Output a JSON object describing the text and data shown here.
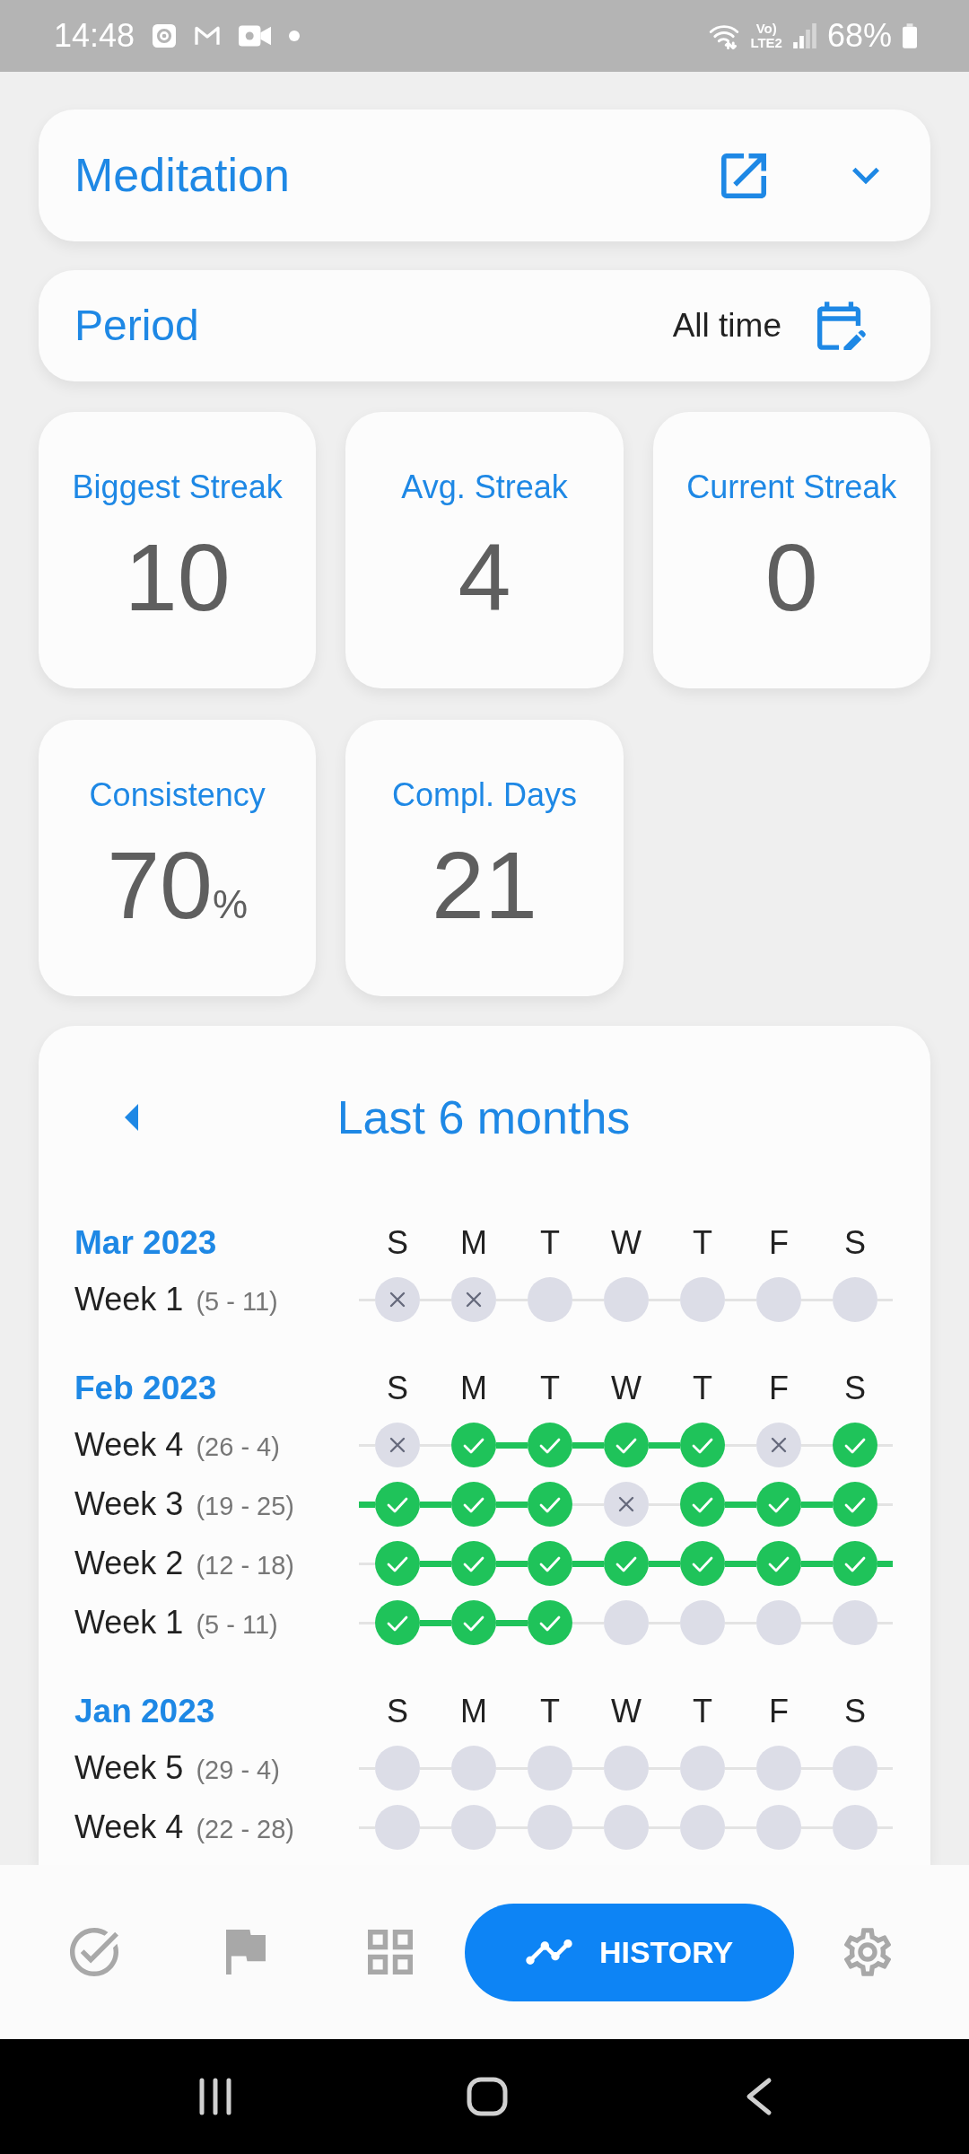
{
  "status_bar": {
    "time": "14:48",
    "network_label": [
      "Vo)",
      "LTE2"
    ],
    "battery": "68%"
  },
  "habit": {
    "title": "Meditation"
  },
  "period": {
    "label": "Period",
    "value": "All time"
  },
  "stats": [
    {
      "label": "Biggest Streak",
      "value": "10"
    },
    {
      "label": "Avg. Streak",
      "value": "4"
    },
    {
      "label": "Current Streak",
      "value": "0"
    },
    {
      "label": "Consistency",
      "value": "70",
      "unit": "%"
    },
    {
      "label": "Compl. Days",
      "value": "21"
    }
  ],
  "history": {
    "title": "Last 6 months",
    "months": [
      {
        "name": "Mar 2023",
        "weekdays": [
          "S",
          "M",
          "T",
          "W",
          "T",
          "F",
          "S"
        ],
        "weeks": [
          {
            "label": "Week 1",
            "range": "(5 - 11)",
            "days": [
              {
                "done": false,
                "missed": true
              },
              {
                "done": false,
                "missed": true
              },
              {
                "done": false,
                "missed": false
              },
              {
                "done": false,
                "missed": false
              },
              {
                "done": false,
                "missed": false
              },
              {
                "done": false,
                "missed": false
              },
              {
                "done": false,
                "missed": false
              }
            ]
          }
        ]
      },
      {
        "name": "Feb 2023",
        "weekdays": [
          "S",
          "M",
          "T",
          "W",
          "T",
          "F",
          "S"
        ],
        "weeks": [
          {
            "label": "Week 4",
            "range": "(26 - 4)",
            "days": [
              {
                "done": false,
                "missed": true
              },
              {
                "done": true,
                "missed": false
              },
              {
                "done": true,
                "missed": false
              },
              {
                "done": true,
                "missed": false
              },
              {
                "done": true,
                "missed": false
              },
              {
                "done": false,
                "missed": true
              },
              {
                "done": true,
                "missed": false
              }
            ]
          },
          {
            "label": "Week 3",
            "range": "(19 - 25)",
            "days": [
              {
                "done": true,
                "missed": false
              },
              {
                "done": true,
                "missed": false
              },
              {
                "done": true,
                "missed": false
              },
              {
                "done": false,
                "missed": true
              },
              {
                "done": true,
                "missed": false
              },
              {
                "done": true,
                "missed": false
              },
              {
                "done": true,
                "missed": false
              }
            ]
          },
          {
            "label": "Week 2",
            "range": "(12 - 18)",
            "days": [
              {
                "done": true,
                "missed": false
              },
              {
                "done": true,
                "missed": false
              },
              {
                "done": true,
                "missed": false
              },
              {
                "done": true,
                "missed": false
              },
              {
                "done": true,
                "missed": false
              },
              {
                "done": true,
                "missed": false
              },
              {
                "done": true,
                "missed": false
              }
            ]
          },
          {
            "label": "Week 1",
            "range": "(5 - 11)",
            "days": [
              {
                "done": true,
                "missed": false
              },
              {
                "done": true,
                "missed": false
              },
              {
                "done": true,
                "missed": false
              },
              {
                "done": false,
                "missed": false
              },
              {
                "done": false,
                "missed": false
              },
              {
                "done": false,
                "missed": false
              },
              {
                "done": false,
                "missed": false
              }
            ]
          }
        ]
      },
      {
        "name": "Jan 2023",
        "weekdays": [
          "S",
          "M",
          "T",
          "W",
          "T",
          "F",
          "S"
        ],
        "weeks": [
          {
            "label": "Week 5",
            "range": "(29 - 4)",
            "days": [
              {
                "done": false,
                "missed": false
              },
              {
                "done": false,
                "missed": false
              },
              {
                "done": false,
                "missed": false
              },
              {
                "done": false,
                "missed": false
              },
              {
                "done": false,
                "missed": false
              },
              {
                "done": false,
                "missed": false
              },
              {
                "done": false,
                "missed": false
              }
            ]
          },
          {
            "label": "Week 4",
            "range": "(22 - 28)",
            "days": [
              {
                "done": false,
                "missed": false
              },
              {
                "done": false,
                "missed": false
              },
              {
                "done": false,
                "missed": false
              },
              {
                "done": false,
                "missed": false
              },
              {
                "done": false,
                "missed": false
              },
              {
                "done": false,
                "missed": false
              },
              {
                "done": false,
                "missed": false
              }
            ]
          }
        ]
      }
    ]
  },
  "bottom_nav": {
    "items": [
      {
        "selected": false
      },
      {
        "selected": false
      },
      {
        "selected": false
      },
      {
        "label": "HISTORY",
        "selected": true
      },
      {
        "selected": false
      }
    ]
  }
}
